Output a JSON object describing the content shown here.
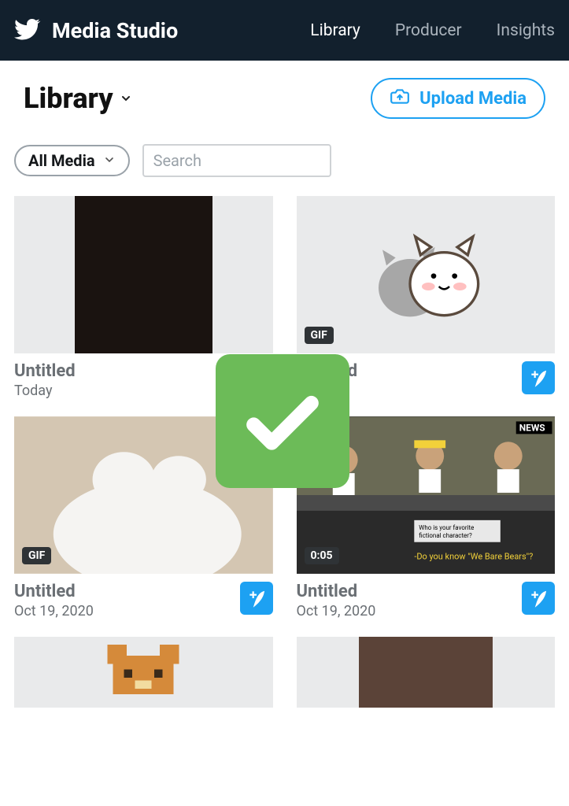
{
  "brand": "Media Studio",
  "nav": {
    "library": "Library",
    "producer": "Producer",
    "insights": "Insights"
  },
  "page_title": "Library",
  "upload_label": "Upload Media",
  "filter_label": "All Media",
  "search_placeholder": "Search",
  "cards": [
    {
      "title": "Untitled",
      "date": "Today",
      "badge": "",
      "show_compose": false
    },
    {
      "title": "Untitled",
      "date": "",
      "badge": "GIF",
      "show_compose": true
    },
    {
      "title": "Untitled",
      "date": "Oct 19, 2020",
      "badge": "GIF",
      "show_compose": true
    },
    {
      "title": "Untitled",
      "date": "Oct 19, 2020",
      "badge": "0:05",
      "show_compose": true
    }
  ]
}
